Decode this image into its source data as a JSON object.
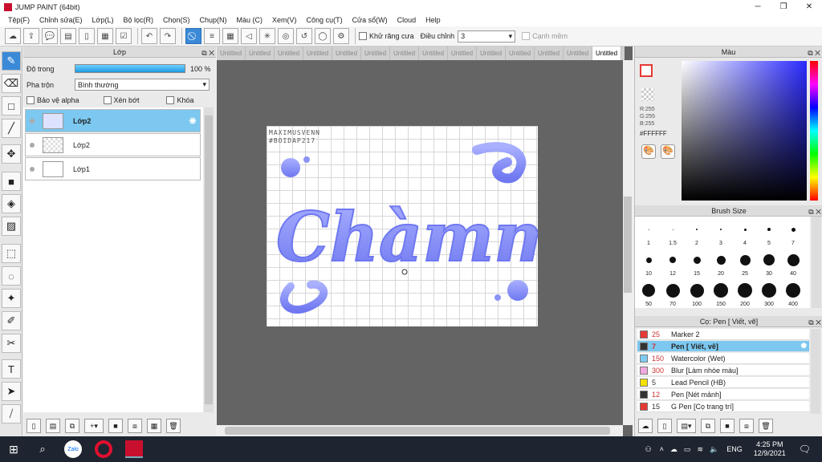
{
  "window": {
    "title": "JUMP PAINT (64bit)"
  },
  "menu": [
    "Tệp(F)",
    "Chỉnh sửa(E)",
    "Lớp(L)",
    "Bộ lọc(R)",
    "Chọn(S)",
    "Chụp(N)",
    "Màu (C)",
    "Xem(V)",
    "Công cụ(T)",
    "Cửa sổ(W)",
    "Cloud",
    "Help"
  ],
  "toolbar": {
    "antialias_label": "Khử răng cưa",
    "adjust_label": "Điều chỉnh",
    "adjust_value": "3",
    "soft_edge_label": "Cạnh mềm"
  },
  "layer_panel": {
    "title": "Lớp",
    "opacity_label": "Độ trong",
    "opacity_value": "100 %",
    "opacity_fraction": 1.0,
    "blend_label": "Pha trộn",
    "blend_value": "Bình thường",
    "protect_alpha": "Bảo vệ alpha",
    "clip": "Xén bớt",
    "lock": "Khóa",
    "layers": [
      {
        "name": "Lớp2",
        "selected": true
      },
      {
        "name": "Lớp2",
        "selected": false
      },
      {
        "name": "Lớp1",
        "selected": false
      }
    ]
  },
  "tabs": [
    "Untitled",
    "Untitled",
    "Untitled",
    "Untitled",
    "Untitled",
    "Untitled",
    "Untitled",
    "Untitled",
    "Untitled",
    "Untitled",
    "Untitled",
    "Untitled",
    "Untitled",
    "Untitled"
  ],
  "canvas": {
    "watermark_line1": "MAXIMUSVENN",
    "watermark_line2": "#BOIDAP217",
    "art_text": "Chàmm"
  },
  "color_panel": {
    "title": "Màu",
    "r": "R:255",
    "g": "G:255",
    "b": "B:255",
    "hex": "#FFFFFF"
  },
  "brush_size": {
    "title": "Brush Size",
    "row1": [
      "1",
      "1.5",
      "2",
      "3",
      "4",
      "5",
      "7"
    ],
    "row2": [
      "10",
      "12",
      "15",
      "20",
      "25",
      "30",
      "40"
    ],
    "row3": [
      "50",
      "70",
      "100",
      "150",
      "200",
      "300",
      "400"
    ]
  },
  "brush_list": {
    "title": "Cọ: Pen [ Viết, vẽ]",
    "items": [
      {
        "size": "25",
        "name": "Marker 2",
        "color": "#e53935"
      },
      {
        "size": "7",
        "name": "Pen [ Viết, vẽ]",
        "color": "#333333",
        "selected": true
      },
      {
        "size": "150",
        "name": "Watercolor (Wet)",
        "color": "#7ecbf0"
      },
      {
        "size": "300",
        "name": "Blur [Làm nhòe màu]",
        "color": "#f0a8e0"
      },
      {
        "size": "5",
        "name": "Lead Pencil (HB)",
        "color": "#f5e000"
      },
      {
        "size": "12",
        "name": "Pen [Nét mảnh]",
        "color": "#333333"
      },
      {
        "size": "15",
        "name": "G Pen [Cọ trang trí]",
        "color": "#e53935"
      }
    ]
  },
  "taskbar": {
    "lang": "ENG",
    "time": "4:25 PM",
    "date": "12/9/2021"
  },
  "colors": {
    "accent": "#3b8ad8",
    "selected_row": "#7cc8f0",
    "lettering": "#8b93f5"
  }
}
